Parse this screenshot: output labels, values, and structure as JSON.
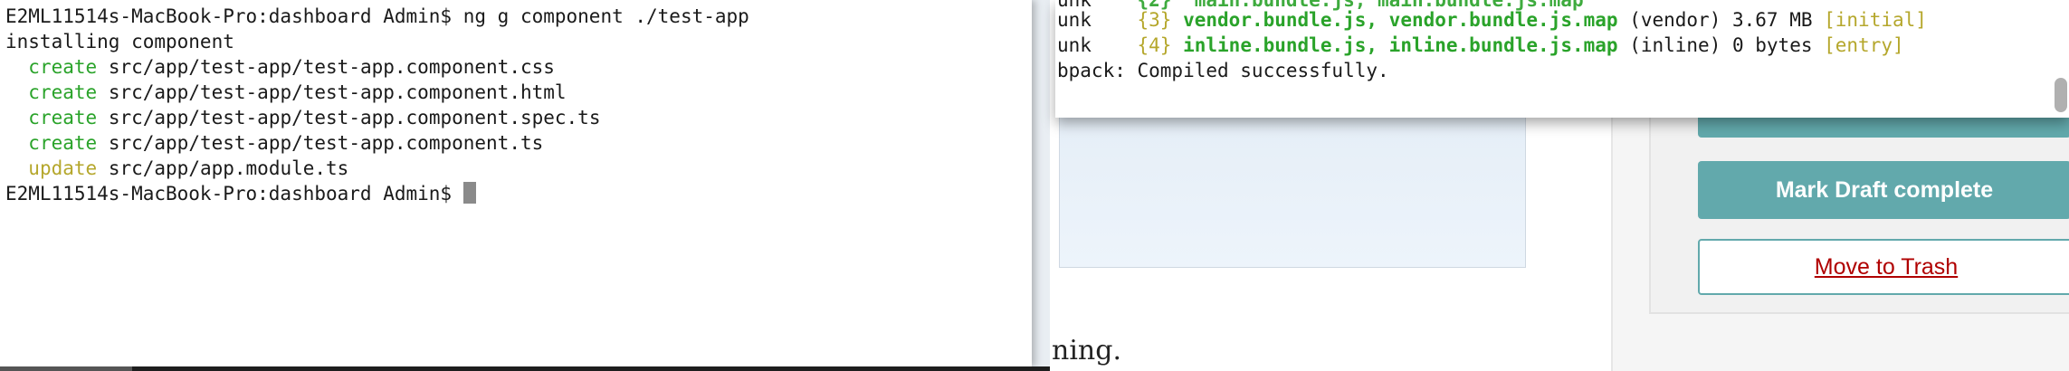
{
  "left_terminal": {
    "lines": [
      {
        "text": "E2ML11514s-MacBook-Pro:dashboard Admin$ ng g component ./test-app"
      },
      {
        "text": "installing component"
      },
      {
        "kw": "create",
        "path": "src/app/test-app/test-app.component.css"
      },
      {
        "kw": "create",
        "path": "src/app/test-app/test-app.component.html"
      },
      {
        "kw": "create",
        "path": "src/app/test-app/test-app.component.spec.ts"
      },
      {
        "kw": "create",
        "path": "src/app/test-app/test-app.component.ts"
      },
      {
        "kw": "update",
        "path": "src/app/app.module.ts"
      },
      {
        "text": "E2ML11514s-MacBook-Pro:dashboard Admin$ "
      }
    ]
  },
  "right_terminal": {
    "line1": {
      "prefix": "unk    ",
      "chunk": "{3}",
      "files": "vendor.bundle.js, vendor.bundle.js.map",
      "rest": " (vendor) 3.67 MB ",
      "tag": "[initial]"
    },
    "line2": {
      "prefix": "unk    ",
      "chunk": "{4}",
      "files": "inline.bundle.js, inline.bundle.js.map",
      "rest": " (inline) 0 bytes ",
      "tag": "[entry]"
    },
    "line3": "bpack: Compiled successfully."
  },
  "page": {
    "body_text_fragment": "ning.",
    "buttons": {
      "mark_draft_complete": "Mark Draft complete",
      "move_to_trash": "Move to Trash"
    }
  }
}
